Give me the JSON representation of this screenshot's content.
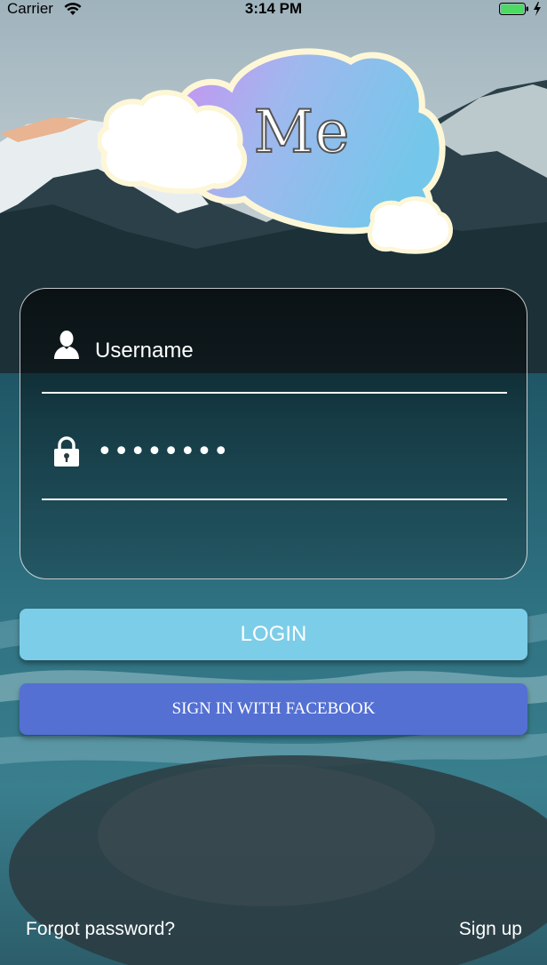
{
  "status_bar": {
    "carrier": "Carrier",
    "time": "3:14 PM",
    "wifi_icon": "wifi-icon",
    "battery_icon": "battery-charging-icon",
    "battery_color": "#4cd964"
  },
  "logo": {
    "text": "Me",
    "cloud_gradient": [
      "#c98ff0",
      "#7ec9ec"
    ],
    "outline_color": "#fdf7d8"
  },
  "login_form": {
    "username_placeholder": "Username",
    "username_icon": "user-icon",
    "password_value": "••••••••",
    "password_icon": "lock-icon"
  },
  "buttons": {
    "login_label": "LOGIN",
    "login_color": "#7ccde8",
    "facebook_label": "SIGN IN WITH FACEBOOK",
    "facebook_color": "#5470d2"
  },
  "footer": {
    "forgot_label": "Forgot password?",
    "signup_label": "Sign up"
  }
}
